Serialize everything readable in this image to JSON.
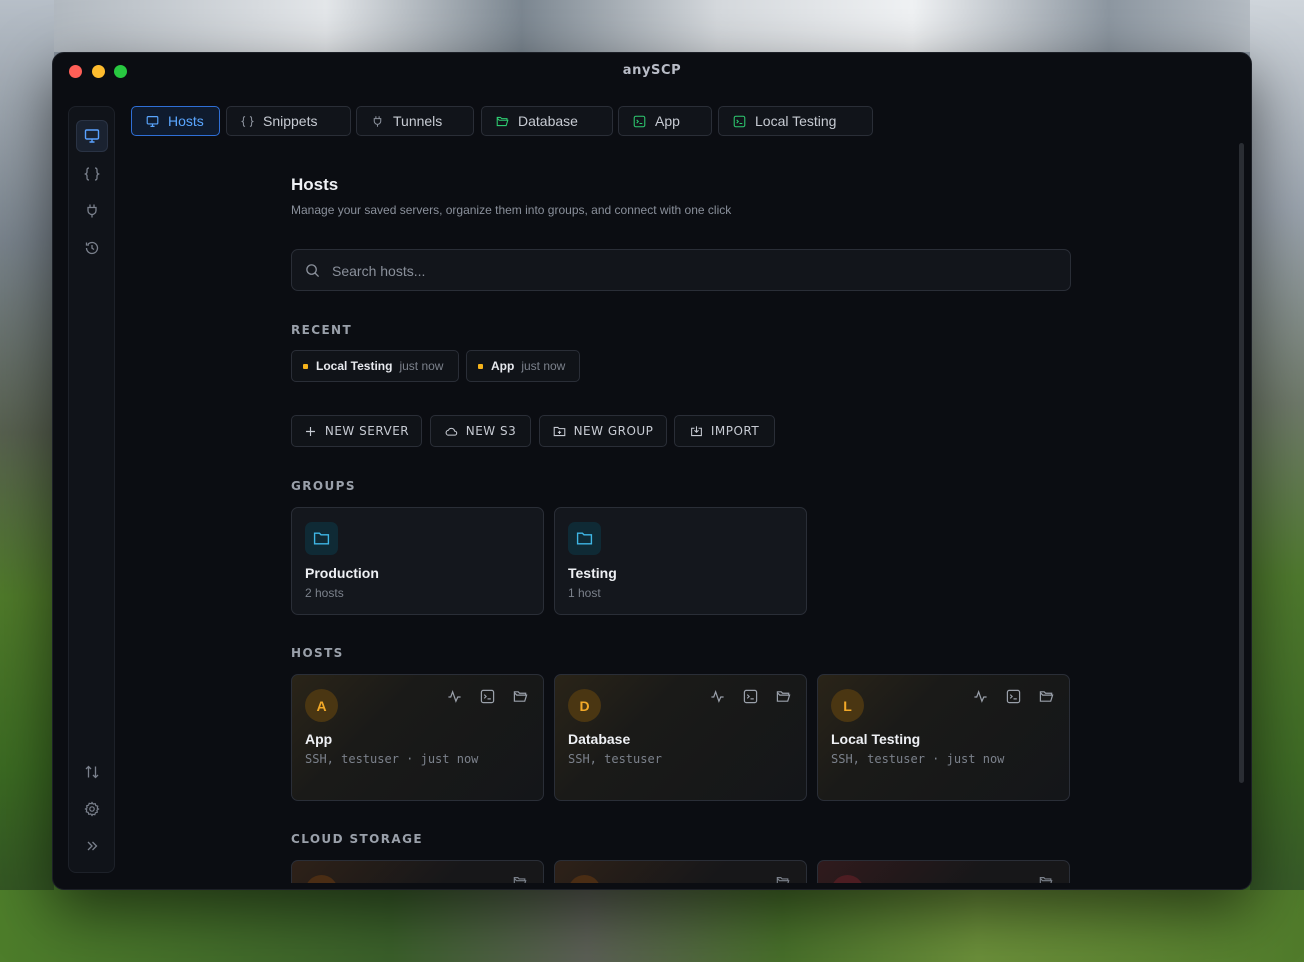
{
  "window": {
    "title": "anySCP"
  },
  "sidebar": {
    "items": [
      {
        "name": "hosts",
        "icon": "monitor-icon",
        "active": true
      },
      {
        "name": "snippets",
        "icon": "braces-icon"
      },
      {
        "name": "tunnels",
        "icon": "plug-icon"
      },
      {
        "name": "history",
        "icon": "history-icon"
      }
    ],
    "bottom_items": [
      {
        "name": "transfers",
        "icon": "arrows-up-down-icon"
      },
      {
        "name": "settings",
        "icon": "gear-icon"
      },
      {
        "name": "expand",
        "icon": "chevrons-right-icon"
      }
    ]
  },
  "tabs": [
    {
      "label": "Hosts",
      "icon": "monitor-icon",
      "active": true
    },
    {
      "label": "Snippets",
      "icon": "braces-icon"
    },
    {
      "label": "Tunnels",
      "icon": "plug-icon"
    },
    {
      "label": "Database",
      "icon": "folder-open-icon"
    },
    {
      "label": "App",
      "icon": "terminal-icon"
    },
    {
      "label": "Local Testing",
      "icon": "terminal-icon"
    }
  ],
  "header": {
    "title": "Hosts",
    "subtitle": "Manage your saved servers, organize them into groups, and connect with one click"
  },
  "search": {
    "placeholder": "Search hosts..."
  },
  "recent": {
    "label": "RECENT",
    "items": [
      {
        "name": "Local Testing",
        "time": "just now"
      },
      {
        "name": "App",
        "time": "just now"
      }
    ]
  },
  "actions": {
    "new_server": "NEW SERVER",
    "new_s3": "NEW S3",
    "new_group": "NEW GROUP",
    "import": "IMPORT"
  },
  "groups": {
    "label": "GROUPS",
    "items": [
      {
        "name": "Production",
        "count": "2 hosts"
      },
      {
        "name": "Testing",
        "count": "1 host"
      }
    ]
  },
  "hosts": {
    "label": "HOSTS",
    "items": [
      {
        "initial": "A",
        "name": "App",
        "meta": "SSH, testuser · just now"
      },
      {
        "initial": "D",
        "name": "Database",
        "meta": "SSH, testuser"
      },
      {
        "initial": "L",
        "name": "Local Testing",
        "meta": "SSH, testuser · just now"
      }
    ]
  },
  "cloud_storage": {
    "label": "CLOUD STORAGE"
  },
  "colors": {
    "accent": "#2f6fd6",
    "accent_text": "#5aa6ff",
    "folder": "#3fb7e6",
    "recent_dot": "#f5b31b",
    "host_avatar": "#f2a928",
    "tab_green": "#2ecb71"
  }
}
